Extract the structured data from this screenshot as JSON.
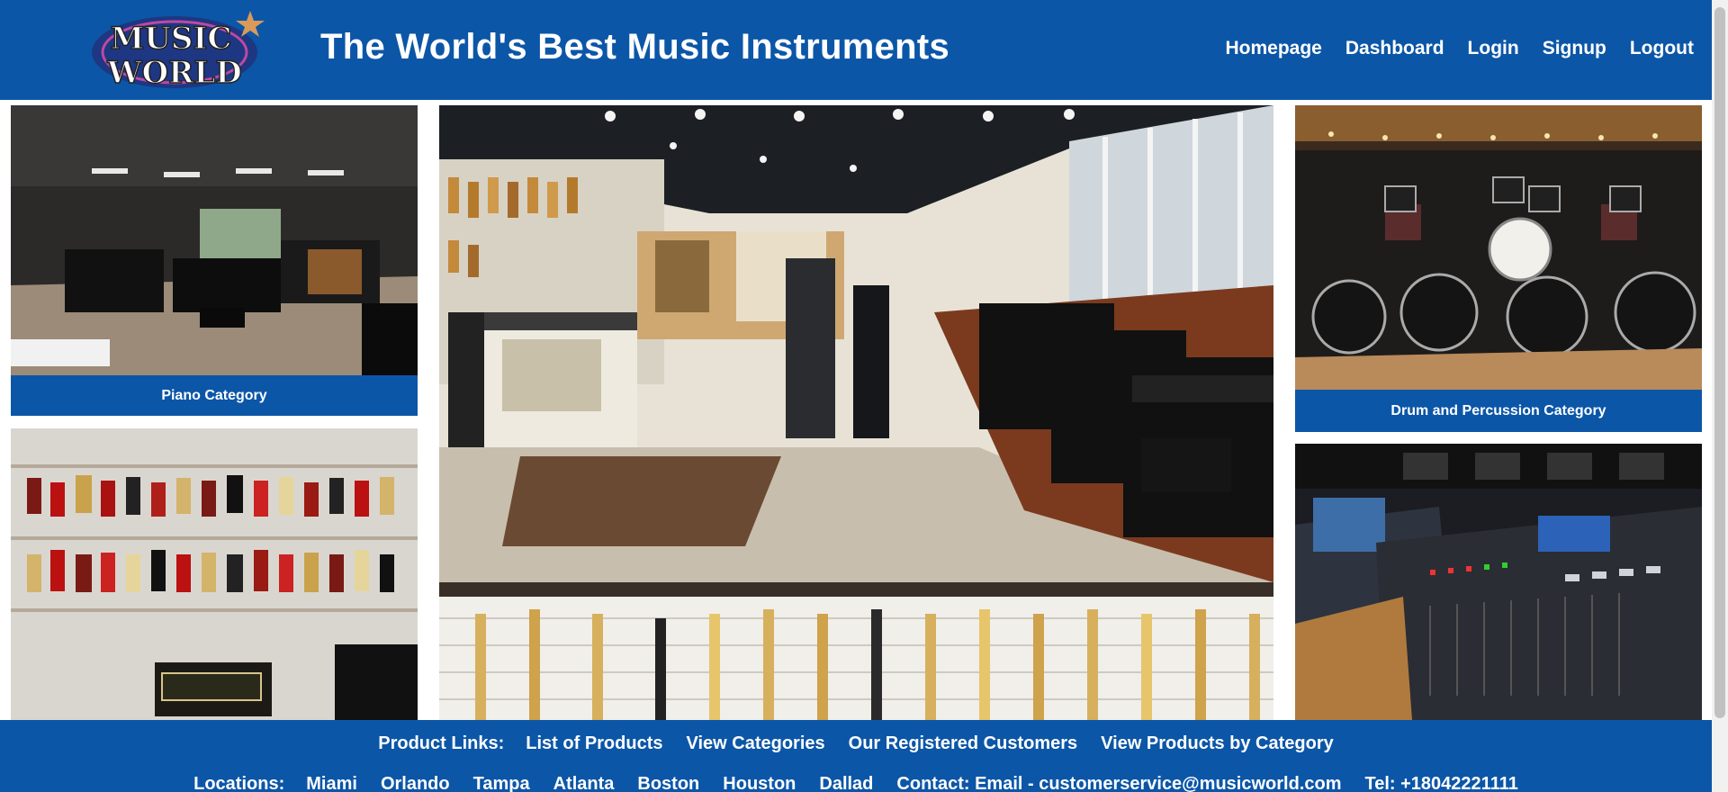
{
  "header": {
    "logo_text_top": "MUSIC",
    "logo_text_bottom": "WORLD",
    "title": "The World's Best Music Instruments",
    "nav": [
      {
        "label": "Homepage"
      },
      {
        "label": "Dashboard"
      },
      {
        "label": "Login"
      },
      {
        "label": "Signup"
      },
      {
        "label": "Logout"
      }
    ]
  },
  "categories": {
    "piano": "Piano Category",
    "drums": "Drum and Percussion Category"
  },
  "footer": {
    "product_links_heading": "Product Links:",
    "product_links": [
      {
        "label": "List of Products"
      },
      {
        "label": "View Categories"
      },
      {
        "label": "Our Registered Customers"
      },
      {
        "label": "View Products by Category"
      }
    ],
    "locations_heading": "Locations:",
    "locations": [
      "Miami",
      "Orlando",
      "Tampa",
      "Atlanta",
      "Boston",
      "Houston",
      "Dallad"
    ],
    "contact": "Contact: Email - customerservice@musicworld.com",
    "phone": "Tel: +18042221111"
  },
  "colors": {
    "brand_blue": "#0c56a7",
    "white": "#ffffff"
  }
}
